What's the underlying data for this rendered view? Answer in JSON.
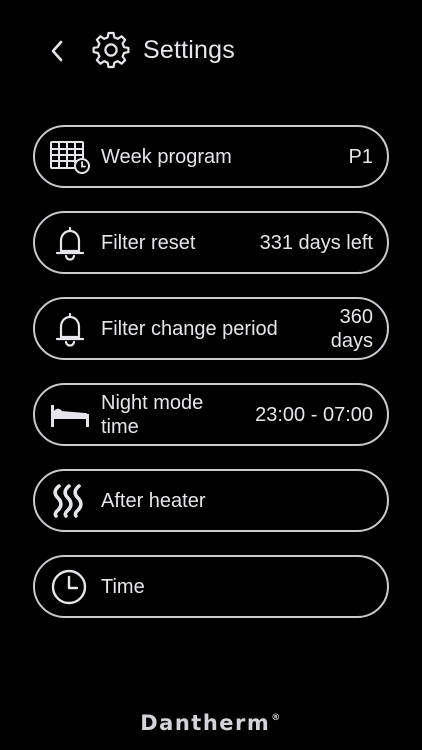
{
  "header": {
    "title": "Settings",
    "back_icon": "chevron-left-icon",
    "title_icon": "gear-icon"
  },
  "menu": {
    "items": [
      {
        "label": "Week program",
        "value": "P1",
        "icon": "calendar-clock-icon"
      },
      {
        "label": "Filter reset",
        "value": "331 days left",
        "icon": "bell-icon"
      },
      {
        "label": "Filter change period",
        "value": "360 days",
        "icon": "bell-icon"
      },
      {
        "label": "Night mode time",
        "value": "23:00 - 07:00",
        "icon": "bed-icon"
      },
      {
        "label": "After heater",
        "value": "",
        "icon": "heat-waves-icon"
      },
      {
        "label": "Time",
        "value": "",
        "icon": "clock-icon"
      }
    ]
  },
  "footer": {
    "brand": "Dantherm",
    "brand_mark": "®"
  },
  "colors": {
    "background": "#000000",
    "text": "#e6e6ea",
    "outline": "#c9c9ce"
  }
}
